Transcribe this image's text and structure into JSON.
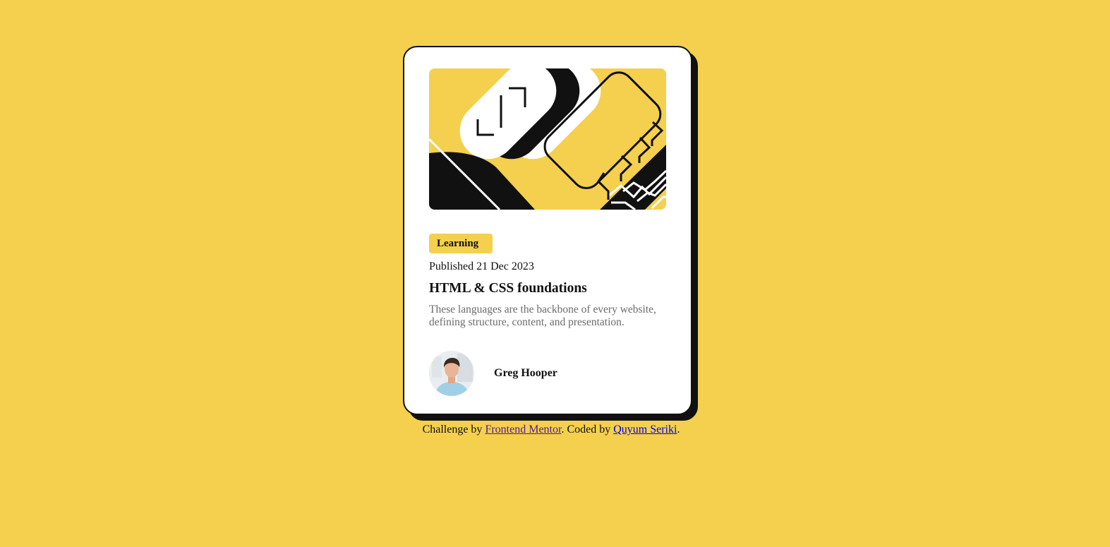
{
  "card": {
    "category": "Learning",
    "published": "Published 21 Dec 2023",
    "title": "HTML & CSS foundations",
    "description": "These languages are the backbone of every website, defining structure, content, and presentation.",
    "author": {
      "name": "Greg Hooper",
      "avatar_icon": "person-portrait-icon"
    },
    "illustration_icon": "code-brackets-illustration-icon"
  },
  "attribution": {
    "prefix": "Challenge by ",
    "link1": "Frontend Mentor",
    "middle": ". Coded by ",
    "link2": "Quyum Seriki",
    "suffix": "."
  },
  "colors": {
    "background": "#f4d04e",
    "card": "#ffffff",
    "ink": "#111111",
    "muted": "#6b6b6b"
  }
}
